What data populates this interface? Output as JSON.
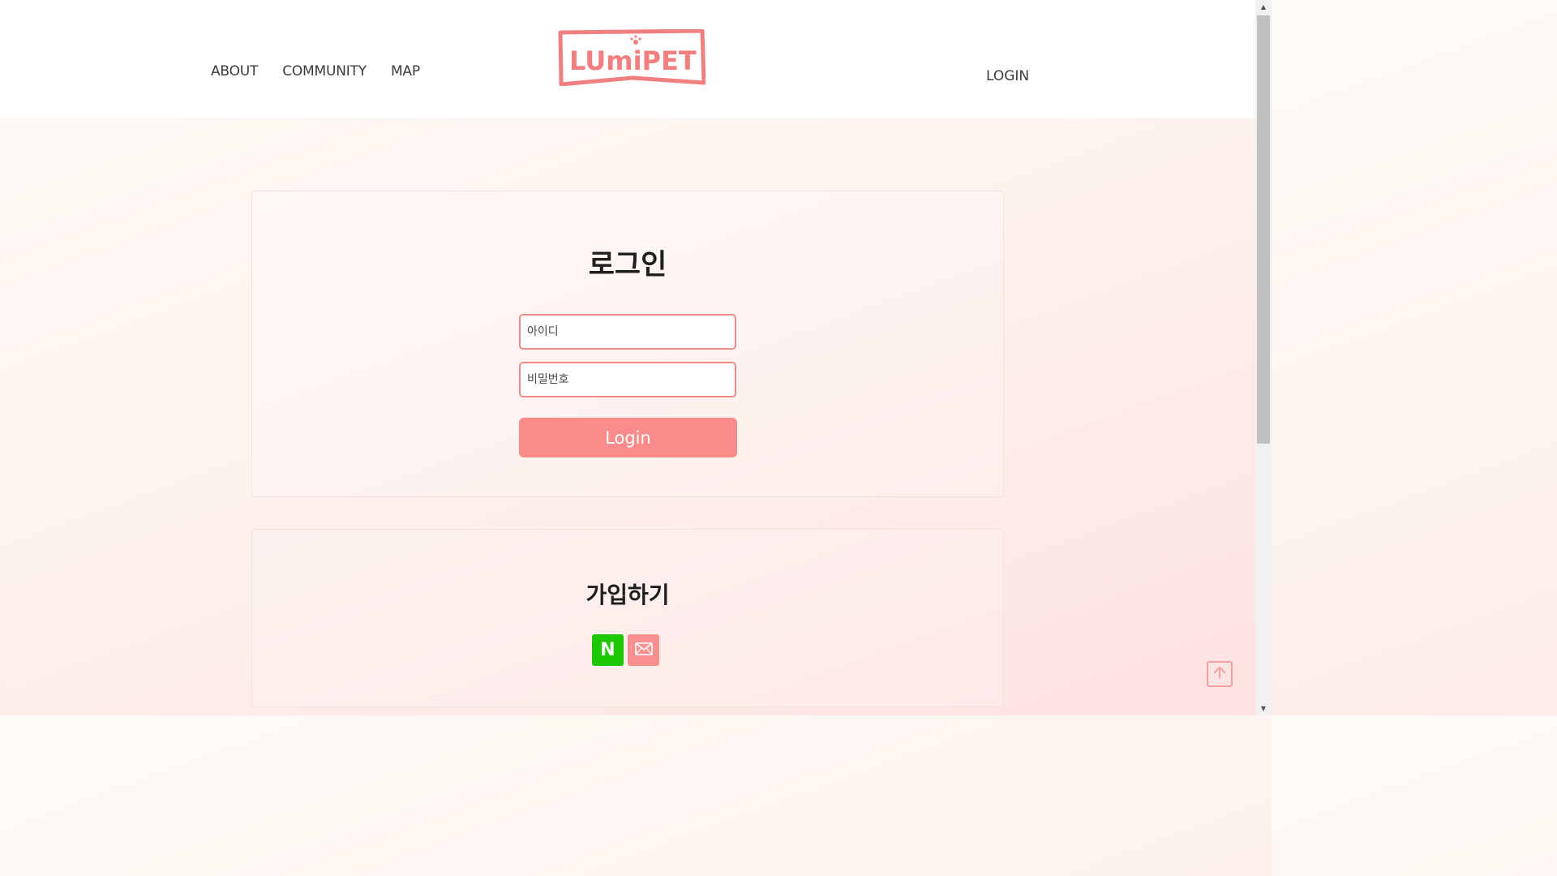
{
  "header": {
    "nav": [
      "ABOUT",
      "COMMUNITY",
      "MAP"
    ],
    "logo_text": "LUmiPET",
    "login_link": "LOGIN"
  },
  "login_card": {
    "title": "로그인",
    "id_placeholder": "아이디",
    "pw_placeholder": "비밀번호",
    "button_label": "Login"
  },
  "signup_card": {
    "title": "가입하기",
    "naver_label": "N"
  },
  "colors": {
    "accent": "#fb8a8a",
    "field_border": "#f08a8a",
    "naver_green": "#1ec800"
  },
  "icons": {
    "email": "envelope-icon",
    "to_top": "arrow-up-icon"
  }
}
